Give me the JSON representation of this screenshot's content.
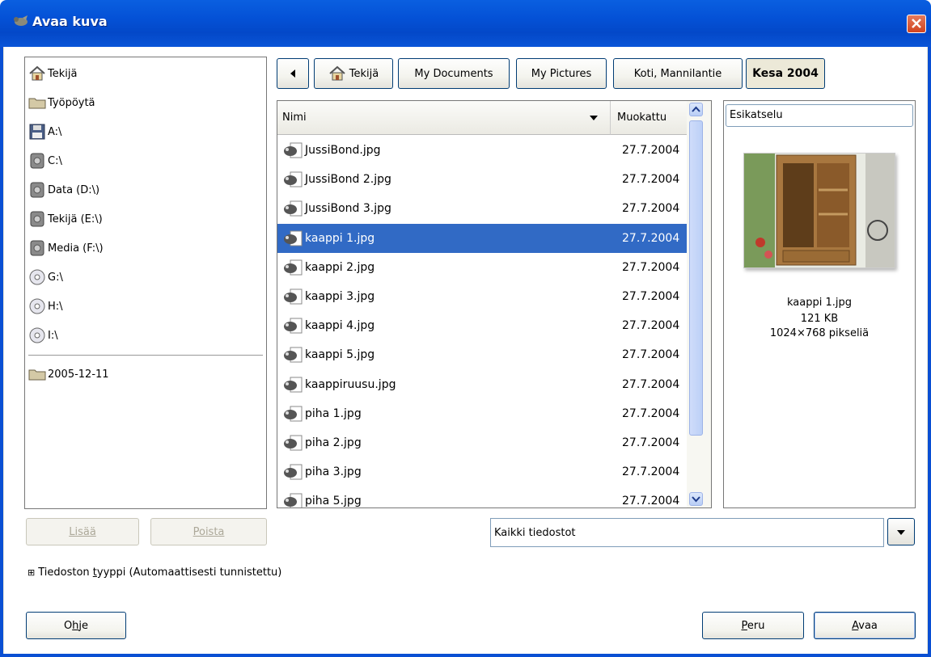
{
  "window": {
    "title": "Avaa kuva"
  },
  "places": {
    "items": [
      {
        "label": "Tekijä",
        "icon": "home-icon"
      },
      {
        "label": "Työpöytä",
        "icon": "folder-icon"
      },
      {
        "label": "A:\\",
        "icon": "floppy-icon"
      },
      {
        "label": "C:\\",
        "icon": "harddisk-icon"
      },
      {
        "label": "Data (D:\\)",
        "icon": "harddisk-icon"
      },
      {
        "label": "Tekijä (E:\\)",
        "icon": "harddisk-icon"
      },
      {
        "label": "Media (F:\\)",
        "icon": "harddisk-icon"
      },
      {
        "label": "G:\\",
        "icon": "cdrom-icon"
      },
      {
        "label": "H:\\",
        "icon": "cdrom-icon"
      },
      {
        "label": "I:\\",
        "icon": "cdrom-icon"
      }
    ],
    "bookmarks": [
      {
        "label": "2005-12-11",
        "icon": "folder-icon"
      }
    ],
    "add_button": "Lisää",
    "remove_button": "Poista"
  },
  "path_bar": {
    "segments": [
      "Tekijä",
      "My Documents",
      "My Pictures",
      "Koti, Mannilantie",
      "Kesa 2004"
    ],
    "active": "Kesa 2004"
  },
  "file_list": {
    "col_name": "Nimi",
    "col_modified": "Muokattu",
    "rows": [
      {
        "name": "JussiBond.jpg",
        "date": "27.7.2004"
      },
      {
        "name": "JussiBond 2.jpg",
        "date": "27.7.2004"
      },
      {
        "name": "JussiBond 3.jpg",
        "date": "27.7.2004"
      },
      {
        "name": "kaappi 1.jpg",
        "date": "27.7.2004",
        "selected": true
      },
      {
        "name": "kaappi 2.jpg",
        "date": "27.7.2004"
      },
      {
        "name": "kaappi 3.jpg",
        "date": "27.7.2004"
      },
      {
        "name": "kaappi 4.jpg",
        "date": "27.7.2004"
      },
      {
        "name": "kaappi 5.jpg",
        "date": "27.7.2004"
      },
      {
        "name": "kaappiruusu.jpg",
        "date": "27.7.2004"
      },
      {
        "name": "piha 1.jpg",
        "date": "27.7.2004"
      },
      {
        "name": "piha 2.jpg",
        "date": "27.7.2004"
      },
      {
        "name": "piha 3.jpg",
        "date": "27.7.2004"
      },
      {
        "name": "piha 5.jpg",
        "date": "27.7.2004"
      }
    ]
  },
  "preview": {
    "header": "Esikatselu",
    "file_name": "kaappi 1.jpg",
    "file_size": "121 KB",
    "dimensions": "1024×768 pikseliä"
  },
  "filter": {
    "value": "Kaikki tiedostot"
  },
  "file_type_expander": {
    "symbol": "⊞",
    "label_prefix": "Tiedoston ",
    "label_mnemonic": "t",
    "label_suffix": "yyppi (Automaattisesti tunnistettu)"
  },
  "buttons": {
    "help": {
      "pre": "O",
      "mn": "h",
      "post": "je"
    },
    "cancel": {
      "pre": "",
      "mn": "P",
      "post": "eru"
    },
    "open": {
      "pre": "",
      "mn": "A",
      "post": "vaa"
    }
  },
  "colors": {
    "selection": "#316ac5",
    "titlebar": "#0451d6",
    "close": "#d2431f"
  }
}
